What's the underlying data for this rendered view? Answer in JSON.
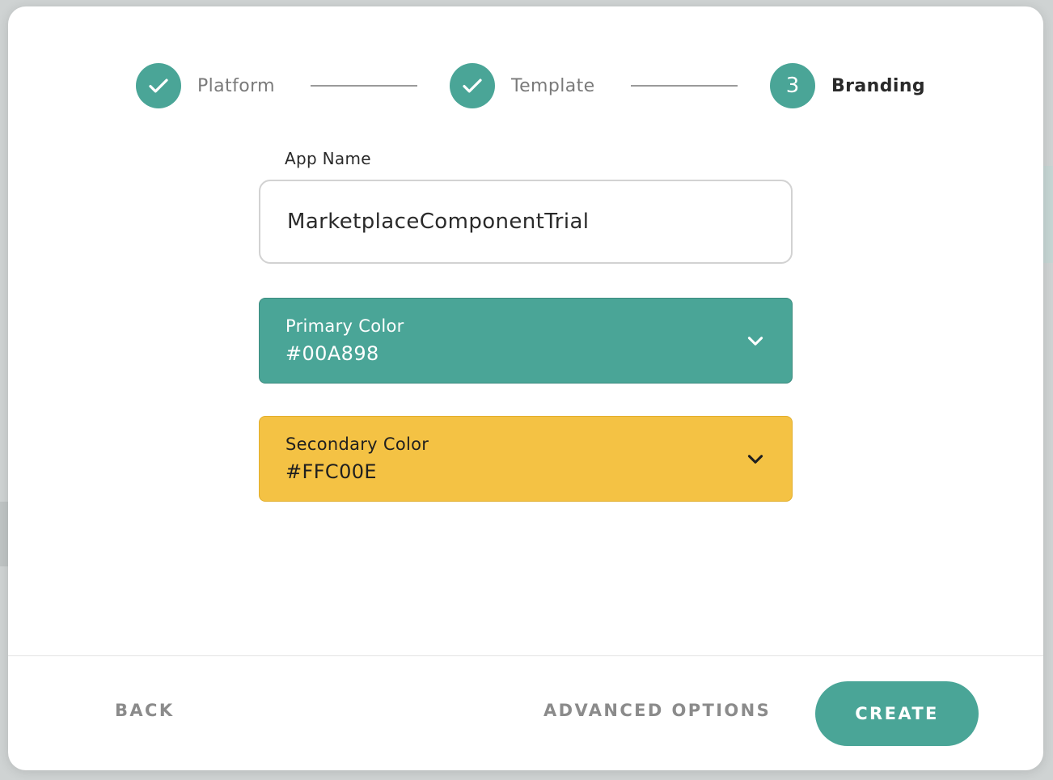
{
  "stepper": {
    "steps": [
      {
        "label": "Platform",
        "status": "completed",
        "icon": "checkmark-icon"
      },
      {
        "label": "Template",
        "status": "completed",
        "icon": "checkmark-icon"
      },
      {
        "label": "Branding",
        "status": "active",
        "number": "3"
      }
    ]
  },
  "form": {
    "app_name_label": "App Name",
    "app_name_value": "MarketplaceComponentTrial",
    "primary": {
      "label": "Primary Color",
      "value": "#00A898",
      "icon": "chevron-down-icon"
    },
    "secondary": {
      "label": "Secondary Color",
      "value": "#FFC00E",
      "icon": "chevron-down-icon"
    }
  },
  "footer": {
    "back_label": "BACK",
    "advanced_label": "ADVANCED OPTIONS",
    "create_label": "CREATE"
  },
  "colors": {
    "accent": "#4AA597",
    "primary_swatch": "#4AA597",
    "secondary_swatch": "#F4C244"
  }
}
